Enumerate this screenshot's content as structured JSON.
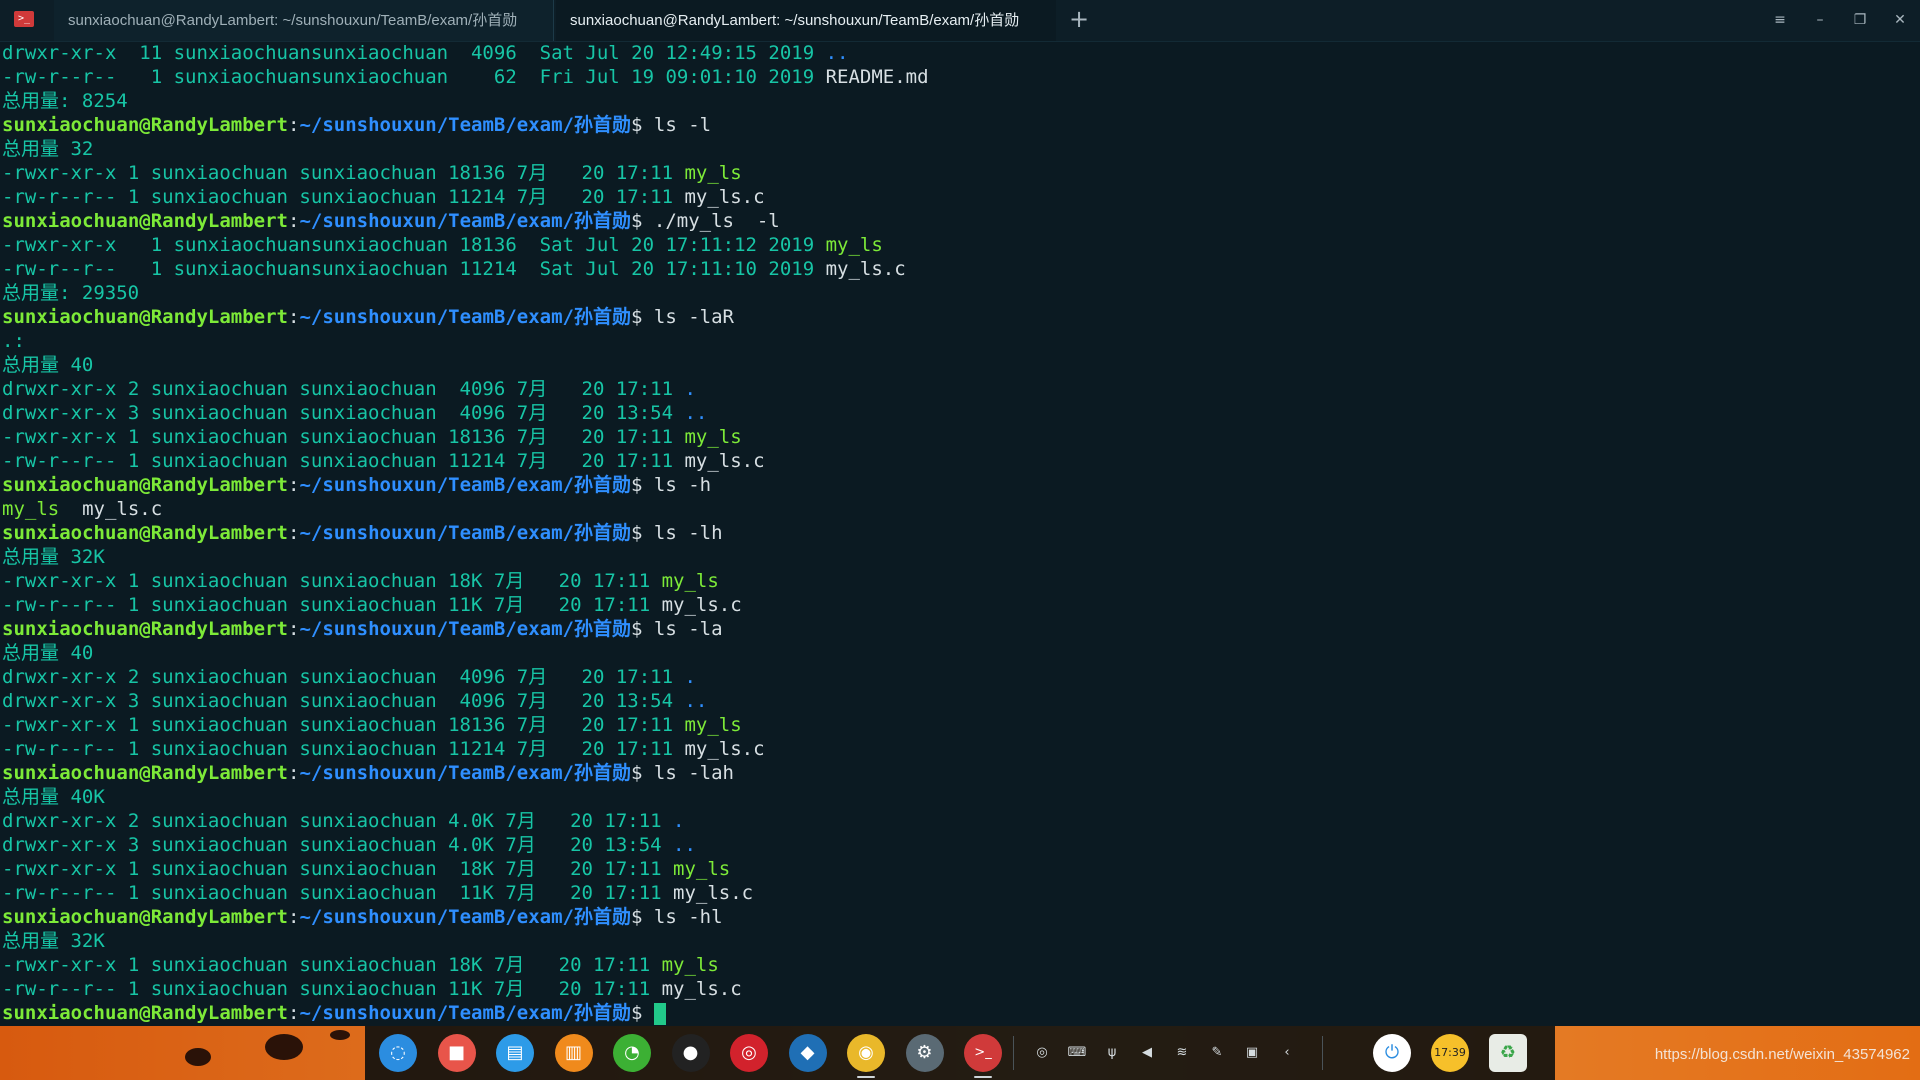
{
  "window": {
    "app_icon_glyph": ">_",
    "tabs": [
      {
        "label": "sunxiaochuan@RandyLambert: ~/sunshouxun/TeamB/exam/孙首勋"
      },
      {
        "label": "sunxiaochuan@RandyLambert: ~/sunshouxun/TeamB/exam/孙首勋"
      }
    ],
    "new_tab_glyph": "+",
    "controls": {
      "menu": "≡",
      "minimize": "–",
      "restore": "❐",
      "close": "✕"
    }
  },
  "prompt": {
    "user_host": "sunxiaochuan@RandyLambert",
    "colon": ":",
    "path": "~/sunshouxun/TeamB/exam/孙首勋",
    "symbol": "$ "
  },
  "terminal_lines": [
    {
      "type": "entry",
      "text": "drwxr-xr-x  11 sunxiaochuansunxiaochuan  4096  Sat Jul 20 12:49:15 2019 ",
      "name": "..",
      "kind": "dir"
    },
    {
      "type": "entry",
      "text": "-rw-r--r--   1 sunxiaochuansunxiaochuan    62  Fri Jul 19 09:01:10 2019 ",
      "name": "README.md",
      "kind": "file"
    },
    {
      "type": "text",
      "text": "总用量: 8254"
    },
    {
      "type": "prompt",
      "cmd": "ls -l"
    },
    {
      "type": "text",
      "text": "总用量 32"
    },
    {
      "type": "entry",
      "text": "-rwxr-xr-x 1 sunxiaochuan sunxiaochuan 18136 7月   20 17:11 ",
      "name": "my_ls",
      "kind": "exec"
    },
    {
      "type": "entry",
      "text": "-rw-r--r-- 1 sunxiaochuan sunxiaochuan 11214 7月   20 17:11 ",
      "name": "my_ls.c",
      "kind": "file"
    },
    {
      "type": "prompt",
      "cmd": "./my_ls  -l"
    },
    {
      "type": "entry",
      "text": "-rwxr-xr-x   1 sunxiaochuansunxiaochuan 18136  Sat Jul 20 17:11:12 2019 ",
      "name": "my_ls",
      "kind": "exec"
    },
    {
      "type": "entry",
      "text": "-rw-r--r--   1 sunxiaochuansunxiaochuan 11214  Sat Jul 20 17:11:10 2019 ",
      "name": "my_ls.c",
      "kind": "file"
    },
    {
      "type": "text",
      "text": "总用量: 29350"
    },
    {
      "type": "prompt",
      "cmd": "ls -laR"
    },
    {
      "type": "text",
      "text": ".:"
    },
    {
      "type": "text",
      "text": "总用量 40"
    },
    {
      "type": "entry",
      "text": "drwxr-xr-x 2 sunxiaochuan sunxiaochuan  4096 7月   20 17:11 ",
      "name": ".",
      "kind": "dir"
    },
    {
      "type": "entry",
      "text": "drwxr-xr-x 3 sunxiaochuan sunxiaochuan  4096 7月   20 13:54 ",
      "name": "..",
      "kind": "dir"
    },
    {
      "type": "entry",
      "text": "-rwxr-xr-x 1 sunxiaochuan sunxiaochuan 18136 7月   20 17:11 ",
      "name": "my_ls",
      "kind": "exec"
    },
    {
      "type": "entry",
      "text": "-rw-r--r-- 1 sunxiaochuan sunxiaochuan 11214 7月   20 17:11 ",
      "name": "my_ls.c",
      "kind": "file"
    },
    {
      "type": "prompt",
      "cmd": "ls -h"
    },
    {
      "type": "multi",
      "items": [
        {
          "name": "my_ls",
          "kind": "exec"
        },
        {
          "sep": "  "
        },
        {
          "name": "my_ls.c",
          "kind": "file"
        }
      ]
    },
    {
      "type": "prompt",
      "cmd": "ls -lh"
    },
    {
      "type": "text",
      "text": "总用量 32K"
    },
    {
      "type": "entry",
      "text": "-rwxr-xr-x 1 sunxiaochuan sunxiaochuan 18K 7月   20 17:11 ",
      "name": "my_ls",
      "kind": "exec"
    },
    {
      "type": "entry",
      "text": "-rw-r--r-- 1 sunxiaochuan sunxiaochuan 11K 7月   20 17:11 ",
      "name": "my_ls.c",
      "kind": "file"
    },
    {
      "type": "prompt",
      "cmd": "ls -la"
    },
    {
      "type": "text",
      "text": "总用量 40"
    },
    {
      "type": "entry",
      "text": "drwxr-xr-x 2 sunxiaochuan sunxiaochuan  4096 7月   20 17:11 ",
      "name": ".",
      "kind": "dir"
    },
    {
      "type": "entry",
      "text": "drwxr-xr-x 3 sunxiaochuan sunxiaochuan  4096 7月   20 13:54 ",
      "name": "..",
      "kind": "dir"
    },
    {
      "type": "entry",
      "text": "-rwxr-xr-x 1 sunxiaochuan sunxiaochuan 18136 7月   20 17:11 ",
      "name": "my_ls",
      "kind": "exec"
    },
    {
      "type": "entry",
      "text": "-rw-r--r-- 1 sunxiaochuan sunxiaochuan 11214 7月   20 17:11 ",
      "name": "my_ls.c",
      "kind": "file"
    },
    {
      "type": "prompt",
      "cmd": "ls -lah"
    },
    {
      "type": "text",
      "text": "总用量 40K"
    },
    {
      "type": "entry",
      "text": "drwxr-xr-x 2 sunxiaochuan sunxiaochuan 4.0K 7月   20 17:11 ",
      "name": ".",
      "kind": "dir"
    },
    {
      "type": "entry",
      "text": "drwxr-xr-x 3 sunxiaochuan sunxiaochuan 4.0K 7月   20 13:54 ",
      "name": "..",
      "kind": "dir"
    },
    {
      "type": "entry",
      "text": "-rwxr-xr-x 1 sunxiaochuan sunxiaochuan  18K 7月   20 17:11 ",
      "name": "my_ls",
      "kind": "exec"
    },
    {
      "type": "entry",
      "text": "-rw-r--r-- 1 sunxiaochuan sunxiaochuan  11K 7月   20 17:11 ",
      "name": "my_ls.c",
      "kind": "file"
    },
    {
      "type": "prompt",
      "cmd": "ls -hl"
    },
    {
      "type": "text",
      "text": "总用量 32K"
    },
    {
      "type": "entry",
      "text": "-rwxr-xr-x 1 sunxiaochuan sunxiaochuan 18K 7月   20 17:11 ",
      "name": "my_ls",
      "kind": "exec"
    },
    {
      "type": "entry",
      "text": "-rw-r--r-- 1 sunxiaochuan sunxiaochuan 11K 7月   20 17:11 ",
      "name": "my_ls.c",
      "kind": "file"
    },
    {
      "type": "prompt",
      "cmd": "",
      "cursor": true
    }
  ],
  "taskbar": {
    "dock_apps": [
      {
        "name": "launcher-icon",
        "glyph": "◌",
        "color": "#2b8de0"
      },
      {
        "name": "screen-recorder-icon",
        "glyph": "■",
        "color": "#e8554a"
      },
      {
        "name": "file-manager-icon",
        "glyph": "▤",
        "color": "#2d9be8"
      },
      {
        "name": "app-store-icon",
        "glyph": "▥",
        "color": "#f08a1c"
      },
      {
        "name": "wechat-icon",
        "glyph": "◔",
        "color": "#3cb034"
      },
      {
        "name": "qq-icon",
        "glyph": "●",
        "color": "#222222"
      },
      {
        "name": "netease-music-icon",
        "glyph": "◎",
        "color": "#d2222c"
      },
      {
        "name": "vscode-icon",
        "glyph": "◆",
        "color": "#1f6fb5"
      },
      {
        "name": "chrome-icon",
        "glyph": "◉",
        "color": "#e9b82a"
      },
      {
        "name": "settings-icon",
        "glyph": "⚙",
        "color": "#5a6a74"
      },
      {
        "name": "terminal-icon",
        "glyph": ">_",
        "color": "#d03a3a"
      }
    ],
    "tray": [
      {
        "name": "netease-tray-icon",
        "glyph": "◎"
      },
      {
        "name": "keyboard-icon",
        "glyph": "⌨"
      },
      {
        "name": "usb-icon",
        "glyph": "ψ"
      },
      {
        "name": "volume-icon",
        "glyph": "◀"
      },
      {
        "name": "wifi-icon",
        "glyph": "≋"
      },
      {
        "name": "pen-icon",
        "glyph": "✎"
      },
      {
        "name": "battery-icon",
        "glyph": "▣"
      },
      {
        "name": "tray-expand-icon",
        "glyph": "‹"
      }
    ],
    "power_glyph": "⏻",
    "clock_text": "17:39",
    "trash_glyph": "♻",
    "watermark": "https://blog.csdn.net/weixin_43574962"
  }
}
